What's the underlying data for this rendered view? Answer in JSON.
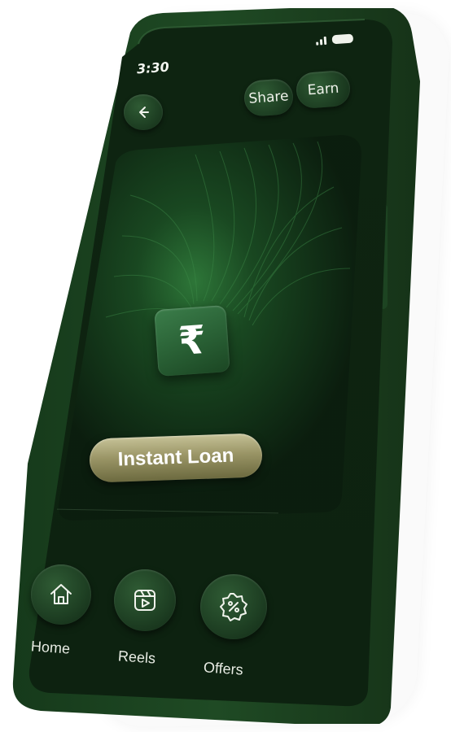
{
  "status_bar": {
    "time": "3:30"
  },
  "header": {
    "back_icon": "arrow-left-icon",
    "share_label": "Share",
    "earn_label": "Earn"
  },
  "hero": {
    "icon": "rupee-icon",
    "icon_glyph": "₹",
    "cta_label": "Instant Loan"
  },
  "bottom_nav": {
    "items": [
      {
        "label": "Home",
        "icon": "home-icon"
      },
      {
        "label": "Reels",
        "icon": "reels-icon"
      },
      {
        "label": "Offers",
        "icon": "offers-badge-icon"
      }
    ]
  },
  "colors": {
    "phone_body": "#1b3d20",
    "screen_bg": "#0f2412",
    "accent_gold": "#a8a271",
    "tile_green": "#2f6e3e"
  }
}
